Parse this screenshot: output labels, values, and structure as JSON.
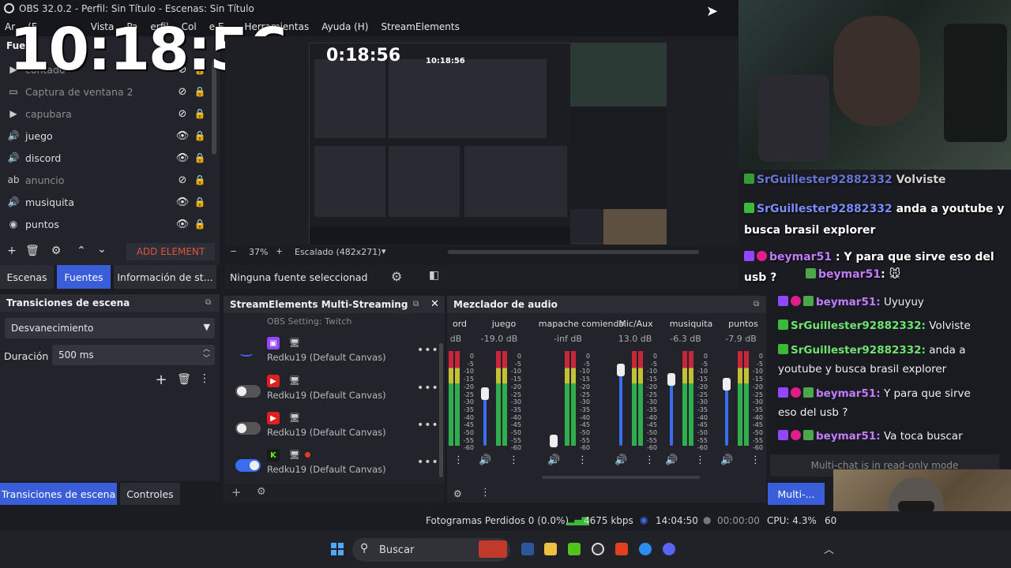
{
  "window": {
    "title": "OBS 32.0.2 - Perfil: Sin Título - Escenas: Sin Título"
  },
  "menu": {
    "file_a": "Ar",
    "file_b": "(F",
    "view": "Vista",
    "dock": "Pa",
    "prof": "erfil",
    "coll": "Col",
    "scene": "e E",
    "tools": "Herramientas",
    "help": "Ayuda (H)",
    "se": "StreamElements"
  },
  "clock": {
    "time": "10:18:56"
  },
  "preview_clock": {
    "time": "0:18:56",
    "time_small": "10:18:56"
  },
  "sources": {
    "header": "Fue",
    "items": [
      {
        "name": "contado",
        "icon": "play-icon",
        "visible": false
      },
      {
        "name": "Captura de ventana 2",
        "icon": "window-icon",
        "visible": false
      },
      {
        "name": "capubara",
        "icon": "play-icon",
        "visible": false
      },
      {
        "name": "juego",
        "icon": "speaker-icon",
        "visible": true
      },
      {
        "name": "discord",
        "icon": "speaker-icon",
        "visible": true
      },
      {
        "name": "anuncio",
        "icon": "text-icon",
        "visible": false
      },
      {
        "name": "musiquita",
        "icon": "speaker-icon",
        "visible": true
      },
      {
        "name": "puntos",
        "icon": "globe-icon",
        "visible": true
      }
    ],
    "add_element": "ADD ELEMENT"
  },
  "tabs": {
    "scenes": "Escenas",
    "sources": "Fuentes",
    "info": "Información de st..."
  },
  "preview": {
    "zoom": "37%",
    "scale": "Escalado (482x271)",
    "no_source": "Ninguna fuente seleccionad"
  },
  "transitions": {
    "header": "Transiciones de escena",
    "selected": "Desvanecimiento",
    "duration_label": "Duración",
    "duration_value": "500 ms",
    "bottom_tab1": "Transiciones de escena",
    "bottom_tab2": "Controles"
  },
  "multistream": {
    "header": "StreamElements Multi-Streaming",
    "partial_top": "OBS Setting: Twitch",
    "rows": [
      {
        "platform": "twitch",
        "canvas": "Redku19 (Default Canvas)",
        "on": null
      },
      {
        "platform": "youtube",
        "canvas": "Redku19 (Default Canvas)",
        "on": false
      },
      {
        "platform": "youtube",
        "canvas": "Redku19 (Default Canvas)",
        "on": false
      },
      {
        "platform": "kick",
        "canvas": "Redku19 (Default Canvas)",
        "on": true
      }
    ]
  },
  "mixer": {
    "header": "Mezclador de audio",
    "channels": [
      {
        "name": "ord",
        "db": "dB",
        "level": 0.2
      },
      {
        "name": "juego",
        "db": "-19.0 dB",
        "level": 0.55
      },
      {
        "name": "mapache comiendo",
        "db": "-inf dB",
        "level": 0.05
      },
      {
        "name": "Mic/Aux",
        "db": "13.0 dB",
        "level": 0.8
      },
      {
        "name": "musiquita",
        "db": "-6.3 dB",
        "level": 0.7
      },
      {
        "name": "puntos",
        "db": "-7.9 dB",
        "level": 0.65
      }
    ],
    "scale": [
      "0",
      "-5",
      "-10",
      "-15",
      "-20",
      "-25",
      "-30",
      "-35",
      "-40",
      "-45",
      "-50",
      "-55",
      "-60"
    ]
  },
  "chat": {
    "overlay_lines": [
      {
        "user": "SrGuillester92882332",
        "text": "Volviste"
      },
      {
        "user": "SrGuillester92882332",
        "text": "anda a youtube y busca brasil explorer"
      },
      {
        "user": "beymar51",
        "text": "Y para que sirve eso del usb ?"
      },
      {
        "user": "beymar51",
        "text": ""
      }
    ],
    "lines": [
      {
        "user": "beymar51:",
        "text": "Uyuyuy"
      },
      {
        "user": "SrGuillester92882332:",
        "text": "Volviste"
      },
      {
        "user": "SrGuillester92882332:",
        "text": "anda a youtube y busca brasil explorer"
      },
      {
        "user": "beymar51:",
        "text": "Y para que sirve eso del usb ?"
      },
      {
        "user": "beymar51:",
        "text": "Va toca buscar"
      }
    ],
    "readonly": "Multi-chat is in read-only mode",
    "multi_btn": "Multi-..."
  },
  "status": {
    "dropped": "Fotogramas Perdidos 0 (0.0%)",
    "kbps": "4675 kbps",
    "time": "14:04:50",
    "rec": "00:00:00",
    "cpu": "CPU: 4.3%",
    "fps": "60"
  },
  "taskbar": {
    "search": "Buscar"
  },
  "colors": {
    "accent": "#3a5ed9",
    "panel": "#23242b",
    "twitch": "#9146ff",
    "youtube": "#e02020",
    "kick": "#53fc18"
  }
}
